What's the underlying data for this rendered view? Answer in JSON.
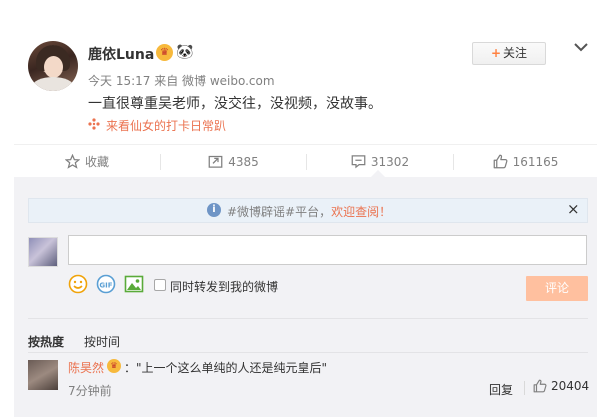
{
  "post": {
    "author": "鹿依Luna",
    "vip_badge": "♛",
    "panda_badge": "🐼",
    "follow_label": "关注",
    "follow_plus": "+",
    "meta": "今天 15:17 来自 微博 weibo.com",
    "text": "一直很尊重吴老师，没交往，没视频，没故事。",
    "topic_link": "来看仙女的打卡日常趴"
  },
  "actions": {
    "favorite": "收藏",
    "repost": "4385",
    "comment": "31302",
    "like": "161165"
  },
  "comment_box": {
    "notice_prefix": "#微博辟谣#平台，",
    "notice_link": "欢迎查阅！",
    "input_placeholder": "",
    "forward_label": "同时转发到我的微博",
    "submit_label": "评论",
    "info_glyph": "i",
    "close_glyph": "×"
  },
  "sort_tabs": [
    "按热度",
    "按时间"
  ],
  "comments": [
    {
      "name": "陈昊然",
      "vip_badge": "♛",
      "text": "：\"上一个这么单纯的人还是纯元皇后\"",
      "time": "7分钟前",
      "reply_label": "回复",
      "likes": "20404"
    }
  ],
  "colors": {
    "accent_orange": "#eb7350",
    "comment_bg": "#f2f2f5",
    "submit_disabled": "#ffc09f",
    "notice_bg": "#eaf1f8"
  }
}
